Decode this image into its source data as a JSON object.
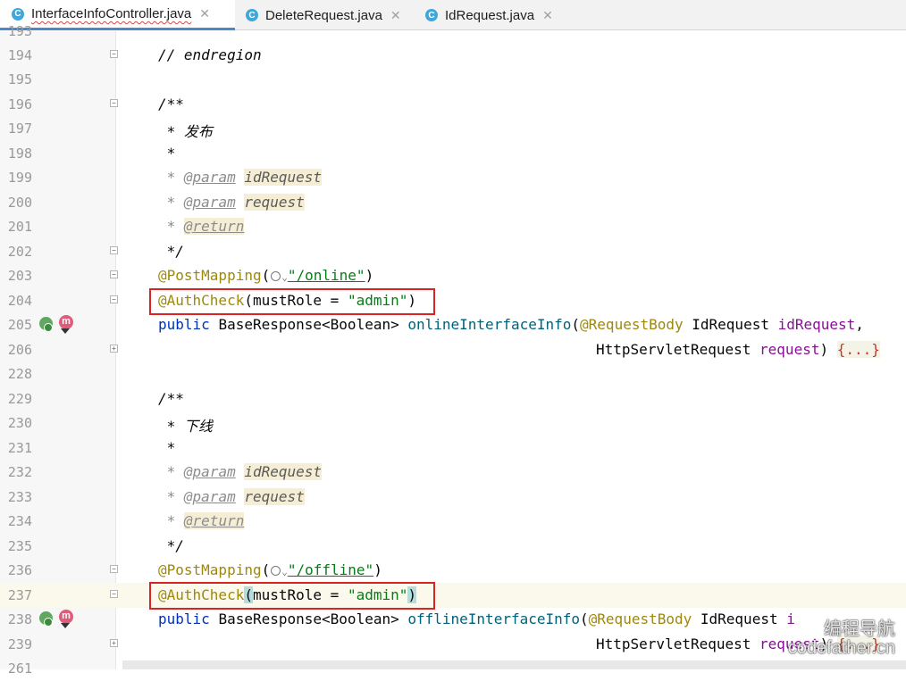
{
  "tabs": [
    {
      "label": "InterfaceInfoController.java",
      "icon": "C"
    },
    {
      "label": "DeleteRequest.java",
      "icon": "C"
    },
    {
      "label": "IdRequest.java",
      "icon": "C"
    }
  ],
  "tab_close": "✕",
  "lines": {
    "l193": "193",
    "l194": {
      "no": "194",
      "text": "// endregion"
    },
    "l195": {
      "no": "195"
    },
    "l196": {
      "no": "196",
      "text": "/**"
    },
    "l197": {
      "no": "197",
      "text": " * 发布"
    },
    "l198": {
      "no": "198",
      "text": " *"
    },
    "l199": {
      "no": "199",
      "star": " * ",
      "tag": "@param",
      "arg": "idRequest"
    },
    "l200": {
      "no": "200",
      "star": " * ",
      "tag": "@param",
      "arg": "request"
    },
    "l201": {
      "no": "201",
      "star": " * ",
      "tag": "@return"
    },
    "l202": {
      "no": "202",
      "text": " */"
    },
    "l203": {
      "no": "203",
      "ann": "@PostMapping",
      "open": "(",
      "path": "\"/online\"",
      "close": ")"
    },
    "l204": {
      "no": "204",
      "ann": "@AuthCheck",
      "open": "(",
      "param": "mustRole",
      "eq": " = ",
      "value": "\"admin\"",
      "close": ")"
    },
    "l205": {
      "no": "205",
      "kw": "public ",
      "type": "BaseResponse<Boolean> ",
      "method": "onlineInterfaceInfo",
      "open": "(",
      "ann": "@RequestBody ",
      "ptype": "IdRequest ",
      "pname": "idRequest",
      "comma": ","
    },
    "l206": {
      "no": "206",
      "ptype": "HttpServletRequest ",
      "pname": "request",
      "close": ") ",
      "folded": "{...}"
    },
    "l228": {
      "no": "228"
    },
    "l229": {
      "no": "229",
      "text": "/**"
    },
    "l230": {
      "no": "230",
      "text": " * 下线"
    },
    "l231": {
      "no": "231",
      "text": " *"
    },
    "l232": {
      "no": "232",
      "star": " * ",
      "tag": "@param",
      "arg": "idRequest"
    },
    "l233": {
      "no": "233",
      "star": " * ",
      "tag": "@param",
      "arg": "request"
    },
    "l234": {
      "no": "234",
      "star": " * ",
      "tag": "@return"
    },
    "l235": {
      "no": "235",
      "text": " */"
    },
    "l236": {
      "no": "236",
      "ann": "@PostMapping",
      "open": "(",
      "path": "\"/offline\"",
      "close": ")"
    },
    "l237": {
      "no": "237",
      "ann": "@AuthCheck",
      "open": "(",
      "param": "mustRole",
      "eq": " = ",
      "value": "\"admin\"",
      "close": ")"
    },
    "l238": {
      "no": "238",
      "kw": "public ",
      "type": "BaseResponse<Boolean> ",
      "method": "offlineInterfaceInfo",
      "open": "(",
      "ann": "@RequestBody ",
      "ptype": "IdRequest ",
      "pname": "i"
    },
    "l239": {
      "no": "239",
      "ptype": "HttpServletRequest ",
      "pname": "request",
      "close": ") ",
      "folded": "{...}"
    },
    "l261": "261"
  },
  "gutter_method_icon": "m",
  "watermark": {
    "line1": "编程导航",
    "line2": "codefather.cn"
  },
  "colors": {
    "annotation_box": "#d92424",
    "annotation": "#9e880d",
    "string": "#067d17",
    "keyword": "#0033b3",
    "method": "#00627a"
  }
}
